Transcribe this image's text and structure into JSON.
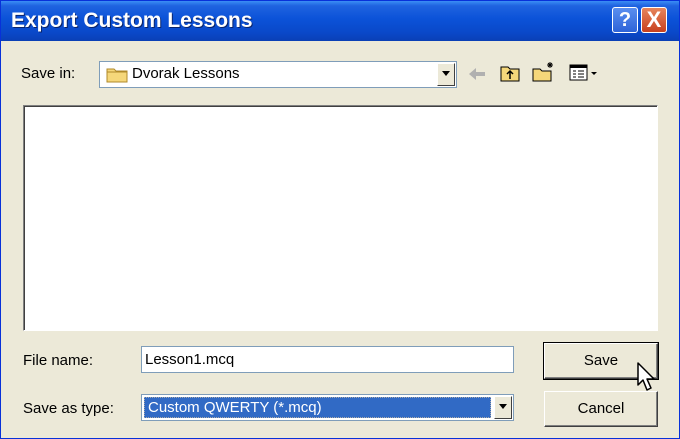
{
  "window": {
    "title": "Export Custom Lessons"
  },
  "titlebar": {
    "help_glyph": "?",
    "close_glyph": "X"
  },
  "save_in": {
    "label": "Save in:",
    "value": "Dvorak Lessons"
  },
  "toolbar": {
    "icons": [
      "back-arrow-icon",
      "up-folder-icon",
      "new-folder-icon",
      "view-menu-icon"
    ]
  },
  "file_list": {
    "items": []
  },
  "file_name": {
    "label": "File name:",
    "value": "Lesson1.mcq"
  },
  "save_as_type": {
    "label": "Save as type:",
    "value": "Custom QWERTY (*.mcq)"
  },
  "buttons": {
    "save": "Save",
    "cancel": "Cancel"
  },
  "colors": {
    "title_bar": "#0a48c8",
    "selection": "#316ac5",
    "dialog_bg": "#ece9d8"
  }
}
